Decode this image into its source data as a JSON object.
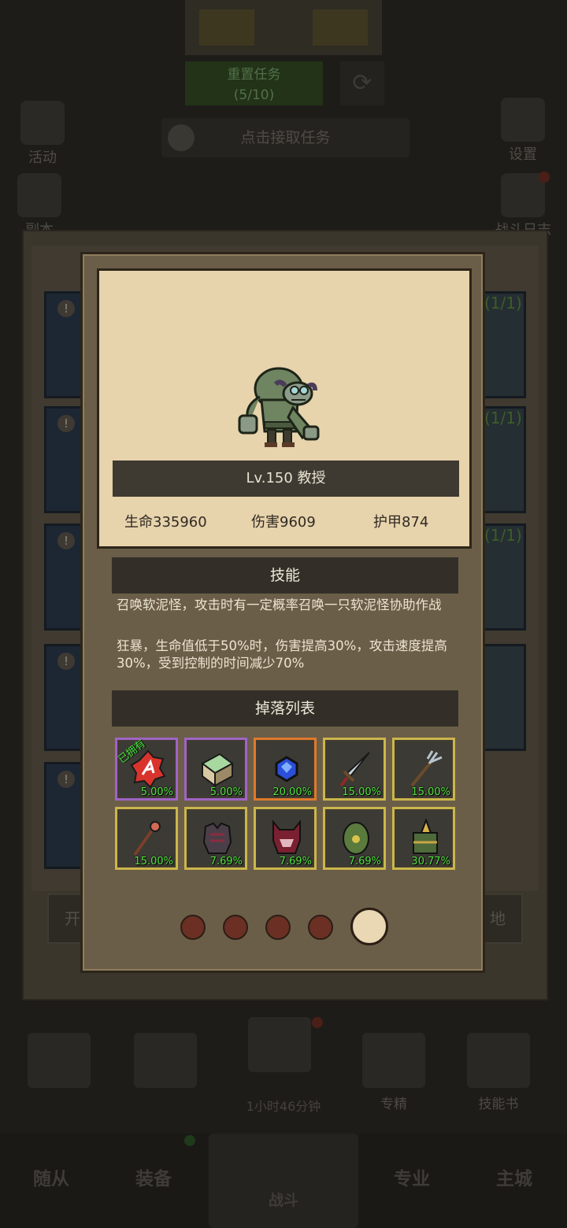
{
  "background": {
    "top_button": {
      "line1": "重置任务",
      "line2": "(5/10)"
    },
    "task_prompt": "点击接取任务",
    "left_icons": [
      {
        "label": "活动"
      },
      {
        "label": "副本"
      }
    ],
    "right_icons": [
      {
        "label": "设置"
      },
      {
        "label": "战斗日志"
      }
    ],
    "right_card_counts": [
      "(1/1)",
      "(1/1)",
      "(1/1)"
    ],
    "left_side_button": "开",
    "right_side_button": "地",
    "bottom_icons": [
      {
        "label": "专精"
      },
      {
        "label": "技能书"
      }
    ],
    "timer": "1小时46分钟",
    "nav": [
      "随从",
      "装备",
      "战斗",
      "专业",
      "主城"
    ]
  },
  "monster": {
    "title": "Lv.150 教授",
    "stats": {
      "hp": "生命335960",
      "dmg": "伤害9609",
      "armor": "护甲874"
    }
  },
  "skills": {
    "header": "技能",
    "items": [
      "召唤软泥怪，攻击时有一定概率召唤一只软泥怪协助作战",
      "狂暴，生命值低于50%时，伤害提高30%，攻击速度提高30%，受到控制的时间减少70%"
    ]
  },
  "drops": {
    "header": "掉落列表",
    "owned_label": "已拥有",
    "items": [
      {
        "icon": "red-rune-icon",
        "rarity": "purple",
        "pct": "5.00%",
        "owned": true
      },
      {
        "icon": "green-skill-book-icon",
        "rarity": "purple",
        "pct": "5.00%"
      },
      {
        "icon": "blue-gem-icon",
        "rarity": "orange",
        "pct": "20.00%"
      },
      {
        "icon": "sword-icon",
        "rarity": "gold",
        "pct": "15.00%"
      },
      {
        "icon": "trident-icon",
        "rarity": "gold",
        "pct": "15.00%"
      },
      {
        "icon": "staff-icon",
        "rarity": "gold",
        "pct": "15.00%"
      },
      {
        "icon": "chest-armor-icon",
        "rarity": "gold",
        "pct": "7.69%"
      },
      {
        "icon": "demon-helmet-icon",
        "rarity": "gold",
        "pct": "7.69%"
      },
      {
        "icon": "green-shield-icon",
        "rarity": "gold",
        "pct": "7.69%"
      },
      {
        "icon": "horned-helmet-icon",
        "rarity": "gold",
        "pct": "30.77%"
      }
    ]
  },
  "pager": {
    "count": 5,
    "active_index": 4
  },
  "colors": {
    "rarity_purple": "#a064c5",
    "rarity_orange": "#de7a2c",
    "rarity_gold": "#cbb64c",
    "drop_pct": "#52e23e"
  }
}
